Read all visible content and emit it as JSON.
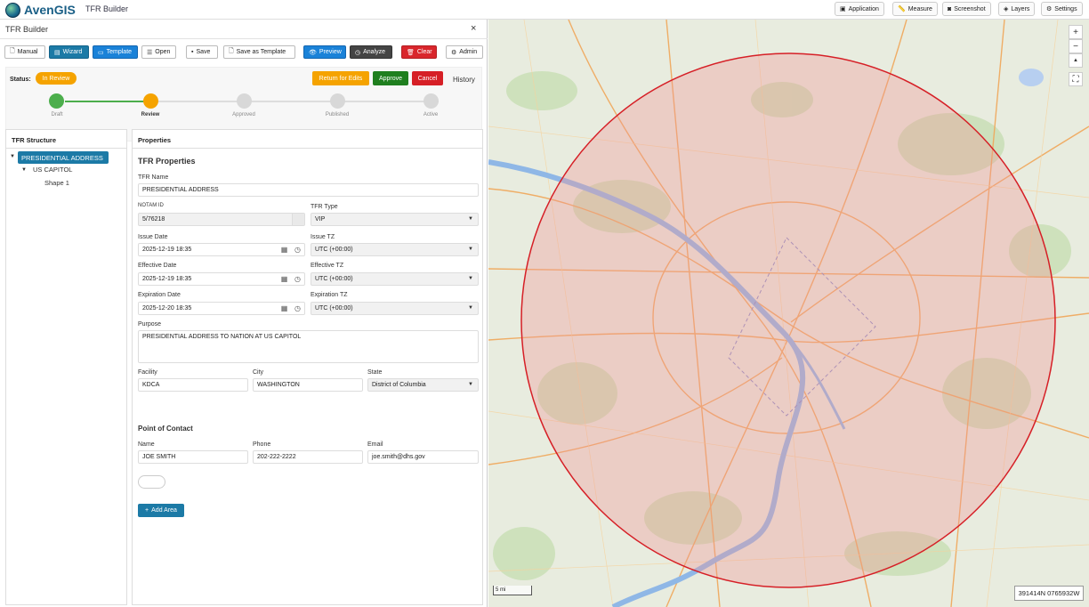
{
  "app": {
    "brand": "AvenGIS",
    "subtitle": "TFR Builder"
  },
  "topbar": {
    "application": "Application",
    "measure": "Measure",
    "screenshot": "Screenshot",
    "layers": "Layers",
    "settings": "Settings"
  },
  "panel": {
    "title": "TFR Builder",
    "close": "×"
  },
  "toolbar": {
    "manual": "Manual",
    "wizard": "Wizard",
    "template": "Template",
    "open": "Open",
    "save": "Save",
    "save_template": "Save as Template",
    "preview": "Preview",
    "analyze": "Analyze",
    "clear": "Clear",
    "admin": "Admin"
  },
  "workflow": {
    "status_label": "Status:",
    "status": "In Review",
    "return_label": "Return for Edits",
    "approve_label": "Approve",
    "cancel_label": "Cancel",
    "history_label": "History",
    "steps": [
      "Draft",
      "Review",
      "Approved",
      "Published",
      "Active"
    ],
    "colors": {
      "draft": "#4cae4c",
      "review": "#f5a300",
      "pending": "#d8d8d8"
    }
  },
  "tree": {
    "header": "TFR Structure",
    "root": "PRESIDENTIAL ADDRESS",
    "child": "US CAPITOL",
    "shape": "Shape 1"
  },
  "properties": {
    "header": "Properties",
    "section_title": "TFR Properties",
    "tfr_name_label": "TFR Name",
    "tfr_name": "PRESIDENTIAL ADDRESS",
    "notam_label": "NOTAM ID",
    "notam": "5/76218",
    "tfr_type_label": "TFR Type",
    "tfr_type": "VIP",
    "issue_date_label": "Issue Date",
    "issue_date": "2025-12-19 18:35",
    "issue_tz_label": "Issue TZ",
    "issue_tz": "UTC (+00:00)",
    "effective_date_label": "Effective Date",
    "effective_date": "2025-12-19 18:35",
    "effective_tz_label": "Effective TZ",
    "effective_tz": "UTC (+00:00)",
    "expiration_date_label": "Expiration Date",
    "expiration_date": "2025-12-20 18:35",
    "expiration_tz_label": "Expiration TZ",
    "expiration_tz": "UTC (+00:00)",
    "purpose_label": "Purpose",
    "purpose": "PRESIDENTIAL ADDRESS TO NATION AT US CAPITOL",
    "facility_label": "Facility",
    "facility": "KDCA",
    "city_label": "City",
    "city": "WASHINGTON",
    "state_label": "State",
    "state": "District of Columbia",
    "poc_title": "Point of Contact",
    "name_label": "Name",
    "name": "JOE SMITH",
    "phone_label": "Phone",
    "phone": "202-222-2222",
    "email_label": "Email",
    "email": "joe.smith@dhs.gov",
    "add_area": "Add Area"
  },
  "map": {
    "zoom_in": "+",
    "zoom_out": "−",
    "north": "▲",
    "scale": "5 mi",
    "coords": "391414N 0765932W",
    "circle_color": "#d61f26"
  }
}
